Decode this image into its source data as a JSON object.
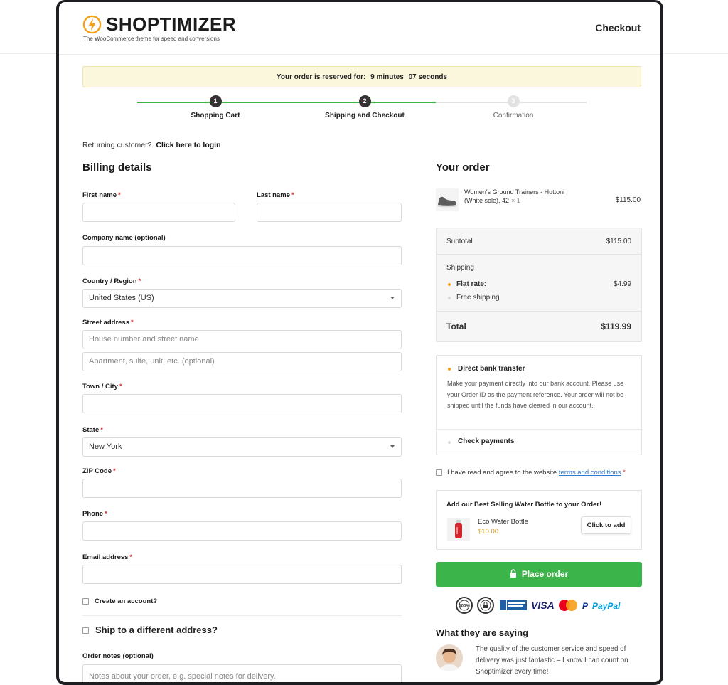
{
  "header": {
    "brand": "SHOPTIMIZER",
    "tagline": "The WooCommerce theme for speed and conversions",
    "page_title": "Checkout"
  },
  "timer": {
    "prefix": "Your order is reserved for:",
    "minutes": "9 minutes",
    "seconds": "07 seconds"
  },
  "steps": [
    {
      "number": "1",
      "label": "Shopping Cart",
      "state": "done"
    },
    {
      "number": "2",
      "label": "Shipping and Checkout",
      "state": "active"
    },
    {
      "number": "3",
      "label": "Confirmation",
      "state": "inactive"
    }
  ],
  "returning": {
    "text": "Returning customer?",
    "link": "Click here to login"
  },
  "billing": {
    "title": "Billing details",
    "first_name_label": "First name",
    "last_name_label": "Last name",
    "company_label": "Company name (optional)",
    "country_label": "Country / Region",
    "country_value": "United States (US)",
    "street_label": "Street address",
    "street_placeholder": "House number and street name",
    "street2_placeholder": "Apartment, suite, unit, etc. (optional)",
    "city_label": "Town / City",
    "state_label": "State",
    "state_value": "New York",
    "zip_label": "ZIP Code",
    "phone_label": "Phone",
    "email_label": "Email address",
    "required_mark": "*",
    "create_account_label": "Create an account?",
    "ship_different_label": "Ship to a different address?",
    "notes_label": "Order notes (optional)",
    "notes_placeholder": "Notes about your order, e.g. special notes for delivery."
  },
  "order": {
    "title": "Your order",
    "item_name": "Women's Ground Trainers - Huttoni (White sole), 42",
    "item_qty": "× 1",
    "item_price": "$115.00",
    "subtotal_label": "Subtotal",
    "subtotal_value": "$115.00",
    "shipping_label": "Shipping",
    "flat_rate_label": "Flat rate:",
    "flat_rate_value": "$4.99",
    "free_shipping_label": "Free shipping",
    "total_label": "Total",
    "total_value": "$119.99"
  },
  "payment": {
    "bank_title": "Direct bank transfer",
    "bank_desc": "Make your payment directly into our bank account. Please use your Order ID as the payment reference. Your order will not be shipped until the funds have cleared in our account.",
    "check_title": "Check payments",
    "terms_text": "I have read and agree to the website",
    "terms_link": "terms and conditions",
    "terms_req": "*"
  },
  "upsell": {
    "title": "Add our Best Selling Water Bottle to your Order!",
    "product_name": "Eco Water Bottle",
    "product_price": "$10.00",
    "button": "Click to add"
  },
  "place_order": "Place order",
  "badges": {
    "visa": "VISA",
    "paypal": "PayPal"
  },
  "testimonial": {
    "title": "What they are saying",
    "quote": "The quality of the customer service and speed of delivery was just fantastic – I know I can count on Shoptimizer every time!"
  },
  "colors": {
    "accent_green": "#3bb54a",
    "step_dark": "#333333",
    "timer_bg": "#fbf7dc",
    "required_red": "#d1302f",
    "brand_orange": "#f2a119",
    "link_blue": "#2b7bd1"
  }
}
